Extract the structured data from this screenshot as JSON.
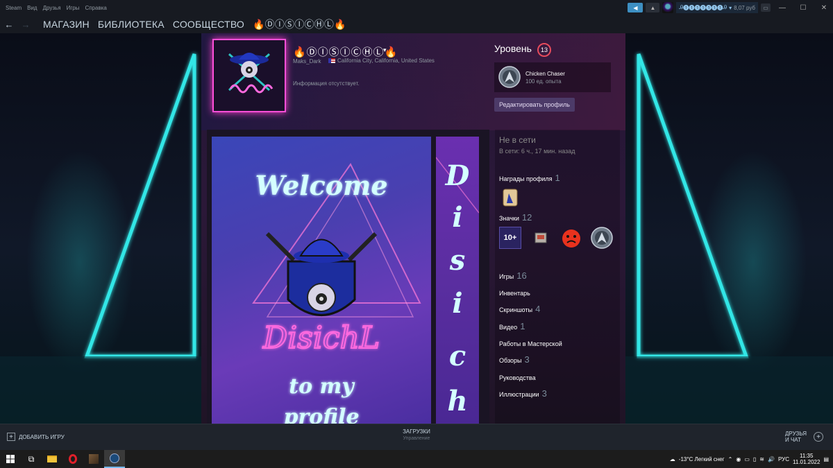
{
  "topbar": {
    "menu": [
      "Steam",
      "Вид",
      "Друзья",
      "Игры",
      "Справка"
    ],
    "account_name": "Ꭿ❶❶❶❶❶❶❶Ꭿ",
    "wallet": "8,07 руб",
    "win_minimize": "—",
    "win_maximize": "☐",
    "win_close": "✕"
  },
  "navbar": {
    "back": "←",
    "forward": "→",
    "links": [
      "МАГАЗИН",
      "БИБЛИОТЕКА",
      "СООБЩЕСТВО",
      "🔥ⒹⒾⓈⒾⒸⒽⓁ🔥"
    ]
  },
  "profile": {
    "persona_name": "🔥ⒹⒾⓈⒾⒸⒽⓁ🔥",
    "real_name": "Maks_Dark",
    "location": "California City, California, United States",
    "summary": "Информация отсутствует.",
    "level_label": "Уровень",
    "level": "13",
    "featured_badge": {
      "name": "Chicken Chaser",
      "xp": "100 ед. опыта"
    },
    "edit_button": "Редактировать профиль"
  },
  "showcase": {
    "welcome_text": "Welcome",
    "logo_text": "DisichL",
    "bottom_text": "to my",
    "bottom_text2": "profile",
    "side_letters": [
      "D",
      "i",
      "s",
      "i",
      "c",
      "h"
    ]
  },
  "right_column": {
    "status": "Не в сети",
    "last_online": "В сети: 6 ч., 17 мин. назад",
    "awards_label": "Награды профиля",
    "awards_count": "1",
    "badges_label": "Значки",
    "badges_count": "12",
    "badge_tenplus": "10+",
    "games_label": "Игры",
    "games_count": "16",
    "inventory_label": "Инвентарь",
    "screenshots_label": "Скриншоты",
    "screenshots_count": "4",
    "videos_label": "Видео",
    "videos_count": "1",
    "workshop_label": "Работы в Мастерской",
    "reviews_label": "Обзоры",
    "reviews_count": "3",
    "guides_label": "Руководства",
    "artwork_label": "Иллюстрации",
    "artwork_count": "3"
  },
  "bottombar": {
    "add_game": "ДОБАВИТЬ ИГРУ",
    "downloads": "ЗАГРУЗКИ",
    "downloads_sub": "Управление",
    "friends_line1": "ДРУЗЬЯ",
    "friends_line2": "И ЧАТ"
  },
  "taskbar": {
    "weather": "-13°C  Легкий снег",
    "language": "РУС",
    "time": "11:35",
    "date": "11.01.2022"
  },
  "colors": {
    "accent_pink": "#ff4fd8",
    "level_ring": "#e64b5c",
    "steam_dark": "#171a21",
    "neon_cyan": "#32e6e6"
  }
}
